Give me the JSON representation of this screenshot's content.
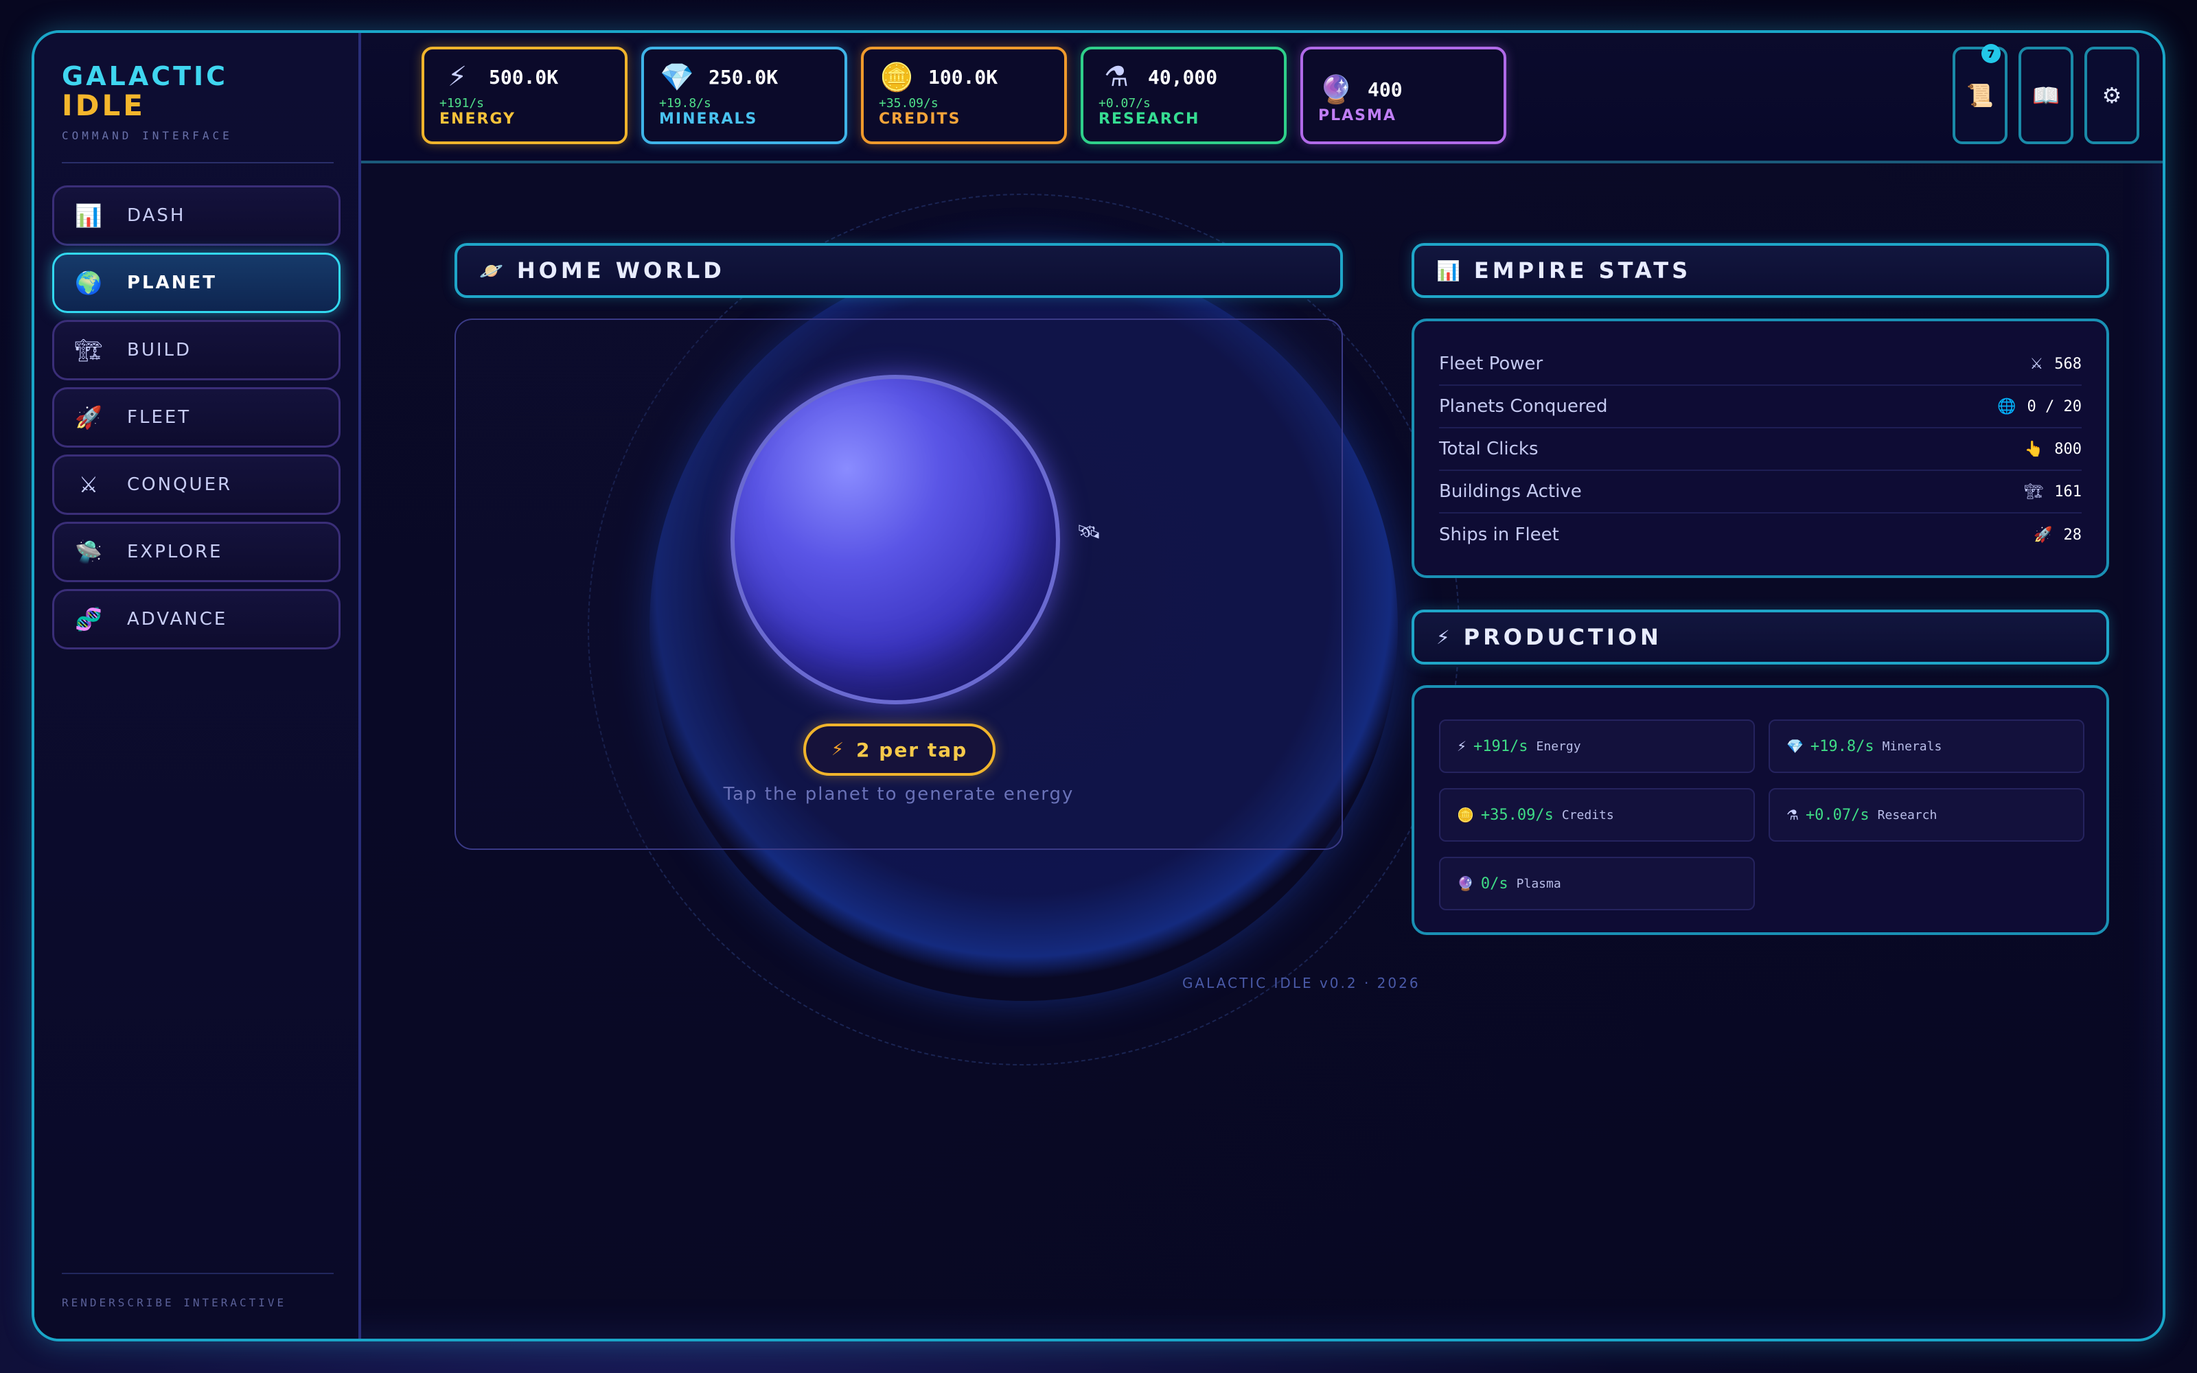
{
  "brand": {
    "line1": "GALACTIC",
    "line2": "IDLE",
    "subtitle": "COMMAND INTERFACE",
    "footer": "RENDERSCRIBE INTERACTIVE"
  },
  "nav": [
    {
      "label": "DASH",
      "icon": "bar-chart-icon",
      "glyph": "📊",
      "active": false
    },
    {
      "label": "PLANET",
      "icon": "globe-icon",
      "glyph": "🌍",
      "active": true
    },
    {
      "label": "BUILD",
      "icon": "crane-icon",
      "glyph": "🏗",
      "active": false
    },
    {
      "label": "FLEET",
      "icon": "rocket-icon",
      "glyph": "🚀",
      "active": false
    },
    {
      "label": "CONQUER",
      "icon": "crossed-swords-icon",
      "glyph": "⚔",
      "active": false
    },
    {
      "label": "EXPLORE",
      "icon": "ufo-icon",
      "glyph": "🛸",
      "active": false
    },
    {
      "label": "ADVANCE",
      "icon": "dna-icon",
      "glyph": "🧬",
      "active": false
    }
  ],
  "resources": {
    "energy": {
      "value": "500.0K",
      "rate": "+191/s",
      "name": "ENERGY",
      "icon": "lightning-icon",
      "glyph": "⚡",
      "color": "#f0b42c"
    },
    "minerals": {
      "value": "250.0K",
      "rate": "+19.8/s",
      "name": "MINERALS",
      "icon": "crystal-icon",
      "glyph": "💎",
      "color": "#3fb4e8"
    },
    "credits": {
      "value": "100.0K",
      "rate": "+35.09/s",
      "name": "CREDITS",
      "icon": "coin-icon",
      "glyph": "🪙",
      "color": "#f09a2c"
    },
    "research": {
      "value": "40,000",
      "rate": "+0.07/s",
      "name": "RESEARCH",
      "icon": "flask-icon",
      "glyph": "⚗",
      "color": "#2fd08a"
    },
    "plasma": {
      "value": "400",
      "name": "PLASMA",
      "icon": "plasma-orb-icon",
      "glyph": "🔮",
      "color": "#b06ae8"
    }
  },
  "top_buttons": {
    "scroll": {
      "icon": "scroll-icon",
      "glyph": "📜",
      "badge": "7"
    },
    "book": {
      "icon": "book-icon",
      "glyph": "📖"
    },
    "settings": {
      "icon": "gear-icon",
      "glyph": "⚙"
    }
  },
  "home_world": {
    "title": "HOME WORLD",
    "icon": "ringed-planet-icon",
    "tap_label": "2 per tap",
    "hint": "Tap the planet to generate energy"
  },
  "empire_stats": {
    "title": "EMPIRE STATS",
    "rows": [
      {
        "label": "Fleet Power",
        "glyph": "⚔",
        "icon": "crossed-swords-icon",
        "value": "568"
      },
      {
        "label": "Planets Conquered",
        "glyph": "🌐",
        "icon": "globe-icon",
        "value": "0 / 20"
      },
      {
        "label": "Total Clicks",
        "glyph": "👆",
        "icon": "pointer-hand-icon",
        "value": "800"
      },
      {
        "label": "Buildings Active",
        "glyph": "🏗",
        "icon": "crane-icon",
        "value": "161"
      },
      {
        "label": "Ships in Fleet",
        "glyph": "🚀",
        "icon": "rocket-icon",
        "value": "28"
      }
    ]
  },
  "production": {
    "title": "PRODUCTION",
    "items": [
      {
        "glyph": "⚡",
        "icon": "lightning-icon",
        "rate": "+191/s",
        "name": "Energy"
      },
      {
        "glyph": "💎",
        "icon": "crystal-icon",
        "rate": "+19.8/s",
        "name": "Minerals"
      },
      {
        "glyph": "🪙",
        "icon": "coin-icon",
        "rate": "+35.09/s",
        "name": "Credits"
      },
      {
        "glyph": "⚗",
        "icon": "flask-icon",
        "rate": "+0.07/s",
        "name": "Research"
      },
      {
        "glyph": "🔮",
        "icon": "plasma-orb-icon",
        "rate": "0/s",
        "name": "Plasma"
      }
    ]
  },
  "version": "GALACTIC IDLE v0.2 · 2026"
}
